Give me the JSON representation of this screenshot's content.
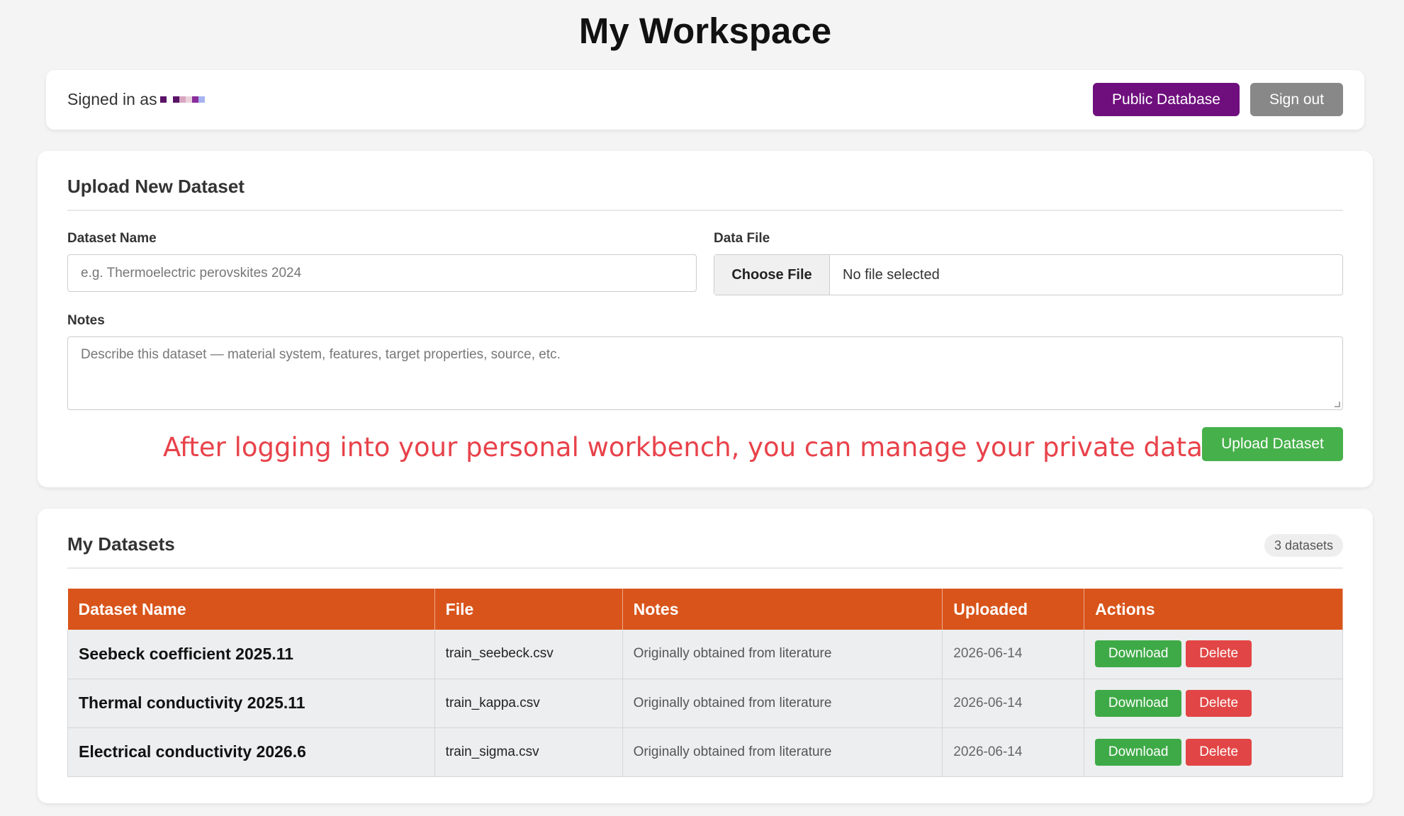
{
  "page": {
    "title": "My Workspace"
  },
  "topbar": {
    "signed_in_label": "Signed in as",
    "public_database_label": "Public Database",
    "sign_out_label": "Sign out",
    "avatar_colors": [
      "#5b1368",
      "#ffffff",
      "#5b1368",
      "#d8a6c2",
      "#ead2dc",
      "#8b2d9c",
      "#a6b3f0"
    ]
  },
  "upload": {
    "heading": "Upload New Dataset",
    "dataset_name_label": "Dataset Name",
    "dataset_name_placeholder": "e.g. Thermoelectric perovskites 2024",
    "data_file_label": "Data File",
    "choose_file_label": "Choose File",
    "file_status": "No file selected",
    "notes_label": "Notes",
    "notes_placeholder": "Describe this dataset — material system, features, target properties, source, etc.",
    "annotation": "After logging into your personal workbench, you can manage your private datasets.",
    "upload_button_label": "Upload Dataset"
  },
  "datasets": {
    "heading": "My Datasets",
    "count_badge": "3 datasets",
    "columns": [
      "Dataset Name",
      "File",
      "Notes",
      "Uploaded",
      "Actions"
    ],
    "download_label": "Download",
    "delete_label": "Delete",
    "rows": [
      {
        "name": "Seebeck coefficient 2025.11",
        "file": "train_seebeck.csv",
        "notes": "Originally obtained from literature",
        "uploaded": "2026-06-14"
      },
      {
        "name": "Thermal conductivity 2025.11",
        "file": "train_kappa.csv",
        "notes": "Originally obtained from literature",
        "uploaded": "2026-06-14"
      },
      {
        "name": "Electrical conductivity 2026.6",
        "file": "train_sigma.csv",
        "notes": "Originally obtained from literature",
        "uploaded": "2026-06-14"
      }
    ]
  },
  "colors": {
    "primary_purple": "#6e0f7d",
    "header_orange": "#d9541a",
    "success_green": "#46b04a",
    "danger_red": "#e24545",
    "annotation_red": "#e8424a"
  }
}
